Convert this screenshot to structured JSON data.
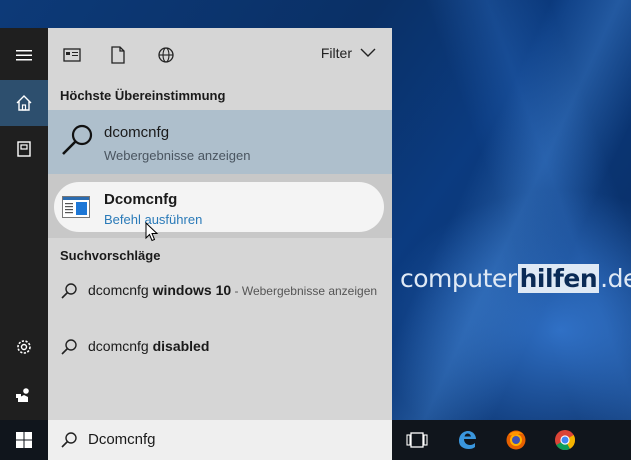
{
  "search_panel": {
    "filter_label": "Filter",
    "best_match_heading": "Höchste Übereinstimmung",
    "best_match": {
      "title": "dcomcnfg",
      "subtitle": "Webergebnisse anzeigen"
    },
    "app_result": {
      "title": "Dcomcnfg",
      "subtitle": "Befehl ausführen"
    },
    "suggestions_heading": "Suchvorschläge",
    "suggestions": [
      {
        "prefix": "dcomcnfg ",
        "bold": "windows 10",
        "note": " - Webergebnisse anzeigen"
      },
      {
        "prefix": "dcomcnfg ",
        "bold": "disabled",
        "note": ""
      }
    ]
  },
  "taskbar": {
    "search_query": "Dcomcnfg"
  },
  "watermark": {
    "part1": "computer",
    "part2": "hilfen",
    "part3": ".de"
  },
  "colors": {
    "rail_bg": "#1f1f1f",
    "panel_bg": "#d6d6d6",
    "best_match_bg": "#aebfcc",
    "link_blue": "#2a7ab8",
    "taskbar_bg": "#10151c"
  },
  "icons": {
    "rail": [
      "hamburger-menu-icon",
      "home-icon",
      "notebook-icon",
      "settings-gear-icon",
      "feedback-icon"
    ],
    "topbar": [
      "apps-filter-icon",
      "documents-filter-icon",
      "web-filter-icon"
    ],
    "taskbar": [
      "windows-start-icon",
      "task-view-icon",
      "edge-icon",
      "firefox-icon",
      "chrome-icon"
    ]
  }
}
